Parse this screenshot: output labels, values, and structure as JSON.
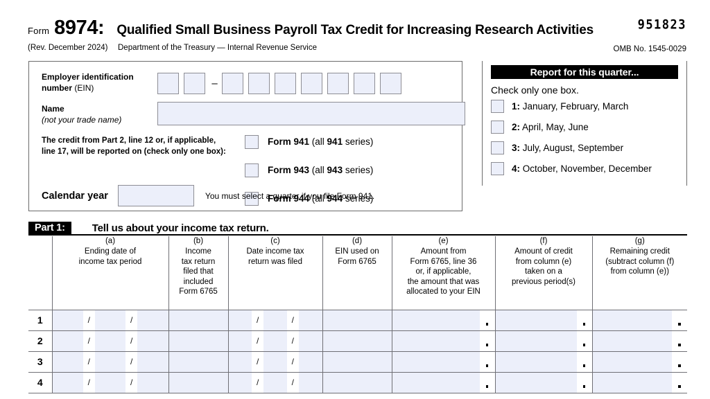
{
  "header": {
    "form_word": "Form",
    "form_number": "8974:",
    "title": "Qualified Small Business Payroll Tax Credit for Increasing Research Activities",
    "revision": "(Rev. December 2024)",
    "department": "Department of the Treasury — Internal Revenue Service",
    "ocr_number": "951823",
    "omb": "OMB No. 1545-0029"
  },
  "left_panel": {
    "ein_label_bold": "Employer identification",
    "ein_label_line2_bold": "number",
    "ein_label_line2_light": "(EIN)",
    "ein_dash": "–",
    "ein_boxes_before": 2,
    "ein_boxes_after": 7,
    "name_label": "Name",
    "name_sublabel": "(not your trade name)",
    "name_value": "",
    "credit_note_line1": "The credit from Part 2, line 12 or, if applicable,",
    "credit_note_line2": "line 17, will be reported on (check only one box):",
    "form_options": [
      {
        "bold": "Form 941",
        "rest_pre": " (all ",
        "rest_bold": "941",
        "rest_post": " series)",
        "checked": false
      },
      {
        "bold": "Form 943",
        "rest_pre": " (all ",
        "rest_bold": "943",
        "rest_post": " series)",
        "checked": false
      },
      {
        "bold": "Form 944",
        "rest_pre": " (all ",
        "rest_bold": "944",
        "rest_post": " series)",
        "checked": false
      }
    ],
    "calendar_year_label": "Calendar year",
    "calendar_year_value": "",
    "calendar_note": "You must select a quarter if you file Form 941."
  },
  "right_panel": {
    "banner": "Report for this quarter...",
    "instruction": "Check only one box.",
    "quarters": [
      {
        "num": "1:",
        "months": "January, February, March",
        "checked": false
      },
      {
        "num": "2:",
        "months": "April, May, June",
        "checked": false
      },
      {
        "num": "3:",
        "months": "July, August, September",
        "checked": false
      },
      {
        "num": "4:",
        "months": "October, November, December",
        "checked": false
      }
    ]
  },
  "part1": {
    "tag": "Part 1:",
    "title": "Tell us about your income tax return."
  },
  "table": {
    "columns": [
      {
        "letter": "(a)",
        "lines": [
          "Ending date of",
          "income tax period"
        ],
        "type": "date"
      },
      {
        "letter": "(b)",
        "lines": [
          "Income",
          "tax return",
          "filed that",
          "included",
          "Form 6765"
        ],
        "type": "plain"
      },
      {
        "letter": "(c)",
        "lines": [
          "Date income tax",
          "return was filed"
        ],
        "type": "date"
      },
      {
        "letter": "(d)",
        "lines": [
          "EIN used on",
          "Form 6765"
        ],
        "type": "plain"
      },
      {
        "letter": "(e)",
        "lines": [
          "Amount from",
          "Form 6765, line 36",
          "or, if applicable,",
          "the amount that was",
          "allocated to your EIN"
        ],
        "type": "money"
      },
      {
        "letter": "(f)",
        "lines": [
          "Amount of credit",
          "from column (e)",
          "taken on a",
          "previous period(s)"
        ],
        "type": "money"
      },
      {
        "letter": "(g)",
        "lines": [
          "Remaining credit",
          "(subtract column (f)",
          "from column (e))"
        ],
        "type": "money"
      }
    ],
    "rows": [
      {
        "number": "1",
        "values": [
          "",
          "",
          "",
          "",
          "",
          "",
          ""
        ]
      },
      {
        "number": "2",
        "values": [
          "",
          "",
          "",
          "",
          "",
          "",
          ""
        ]
      },
      {
        "number": "3",
        "values": [
          "",
          "",
          "",
          "",
          "",
          "",
          ""
        ]
      },
      {
        "number": "4",
        "values": [
          "",
          "",
          "",
          "",
          "",
          "",
          ""
        ]
      }
    ],
    "date_slash": "/",
    "decimal_point": "."
  },
  "colors": {
    "field_fill": "#eceffa",
    "field_border": "#8d8d94",
    "rule": "#6f6f75",
    "banner_bg": "#000000"
  }
}
